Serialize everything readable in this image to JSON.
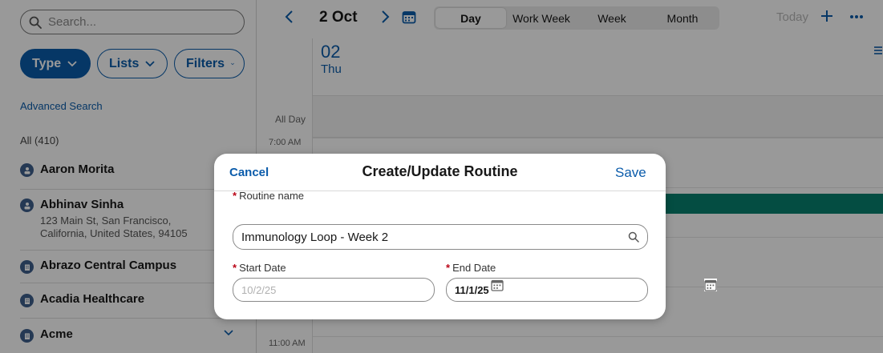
{
  "search": {
    "placeholder": "Search..."
  },
  "filters": {
    "type_label": "Type",
    "lists_label": "Lists",
    "filters_label": "Filters"
  },
  "advanced_search": "Advanced Search",
  "all_count": "All (410)",
  "accounts": [
    {
      "name": "Aaron Morita",
      "address_line1": "",
      "address_line2": ""
    },
    {
      "name": "Abhinav Sinha",
      "address_line1": "123 Main St, San Francisco,",
      "address_line2": "California, United States, 94105"
    },
    {
      "name": "Abrazo Central Campus",
      "address_line1": "",
      "address_line2": ""
    },
    {
      "name": "Acadia Healthcare",
      "address_line1": "",
      "address_line2": ""
    },
    {
      "name": "Acme",
      "address_line1": "",
      "address_line2": ""
    }
  ],
  "calendar": {
    "current_date": "2 Oct",
    "views": [
      "Day",
      "Work Week",
      "Week",
      "Month"
    ],
    "selected_view": "Day",
    "today_label": "Today",
    "day_number": "02",
    "day_name": "Thu",
    "all_day_label": "All Day",
    "time_labels": [
      "7:00 AM",
      "11:00 AM"
    ],
    "event_color": "#08806e"
  },
  "modal": {
    "cancel_label": "Cancel",
    "title": "Create/Update Routine",
    "save_label": "Save",
    "required_mark": "*",
    "routine_name_label": "Routine name",
    "routine_name_value": "Immunology Loop - Week 2",
    "start_date_label": "Start Date",
    "start_date_value": "10/2/25",
    "end_date_label": "End Date",
    "end_date_value": "11/1/25"
  },
  "colors": {
    "brand": "#0b5cab",
    "required": "#ba0517",
    "event": "#08806e"
  }
}
